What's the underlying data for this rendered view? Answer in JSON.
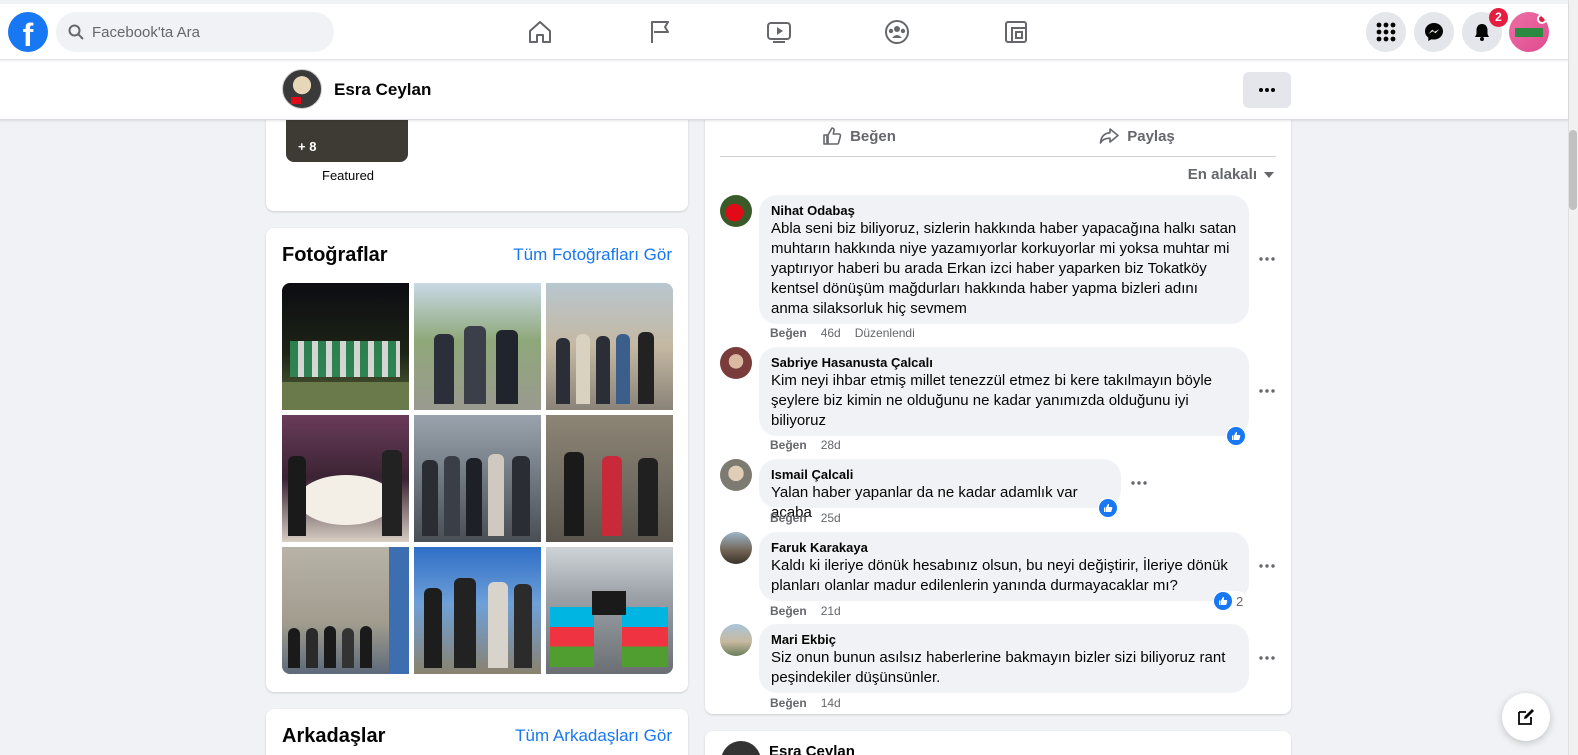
{
  "nav": {
    "logo": "f",
    "search_placeholder": "Facebook'ta Ara",
    "notifications_count": "2"
  },
  "profile_bar": {
    "name": "Esra Ceylan",
    "more": "..."
  },
  "featured": {
    "count": "+ 8",
    "label": "Featured"
  },
  "photos": {
    "title": "Fotoğraflar",
    "see_all": "Tüm Fotoğrafları Gör"
  },
  "friends": {
    "title": "Arkadaşlar",
    "see_all": "Tüm Arkadaşları Gör"
  },
  "post": {
    "like_label": "Beğen",
    "share_label": "Paylaş",
    "sort_label": "En alakalı",
    "comments": [
      {
        "name": "Nihat Odabaş",
        "text": "Abla seni biz biliyoruz, sizlerin hakkında haber yapacağına halkı satan muhtarın hakkında niye yazamıyorlar korkuyorlar mi yoksa muhtar mi yaptırıyor haberi bu arada Erkan izci haber yaparken biz Tokatköy kentsel dönüşüm mağdurları hakkında haber yapma bizleri adını anma silaksorluk hiç sevmem",
        "like": "Beğen",
        "time": "46d",
        "edited": "Düzenlendi"
      },
      {
        "name": "Sabriye Hasanusta Çalcalı",
        "text": "Kim neyi ihbar etmiş millet tenezzül etmez bi kere takılmayın böyle şeylere biz kimin ne olduğunu ne kadar yanımızda olduğunu iyi biliyoruz",
        "like": "Beğen",
        "time": "28d"
      },
      {
        "name": "Ismail Çalcali",
        "text": "Yalan haber yapanlar da ne kadar adamlık var acaba",
        "like": "Beğen",
        "time": "25d"
      },
      {
        "name": "Faruk Karakaya",
        "text": "Kaldı ki ileriye dönük hesabınız olsun, bu neyi değiştirir, İleriye dönük planları olanlar madur edilenlerin yanında durmayacaklar mı?",
        "like": "Beğen",
        "time": "21d",
        "reaction_count": "2"
      },
      {
        "name": "Mari Ekbiç",
        "text": "Siz onun bunun asılsız haberlerine bakmayın bizler sizi biliyoruz rant peşindekiler düşünsünler.",
        "like": "Beğen",
        "time": "14d"
      }
    ]
  },
  "next_post": {
    "name": "Esra Ceylan"
  },
  "colors": {
    "brand": "#1877f2",
    "background": "#f0f2f5",
    "badge": "#e41e3f"
  },
  "icons": [
    "facebook-logo-icon",
    "search-icon",
    "home-icon",
    "flag-icon",
    "video-icon",
    "groups-icon",
    "gaming-icon",
    "menu-grid-icon",
    "messenger-icon",
    "bell-icon",
    "more-icon",
    "like-icon",
    "share-icon",
    "caret-down-icon",
    "compose-icon"
  ]
}
